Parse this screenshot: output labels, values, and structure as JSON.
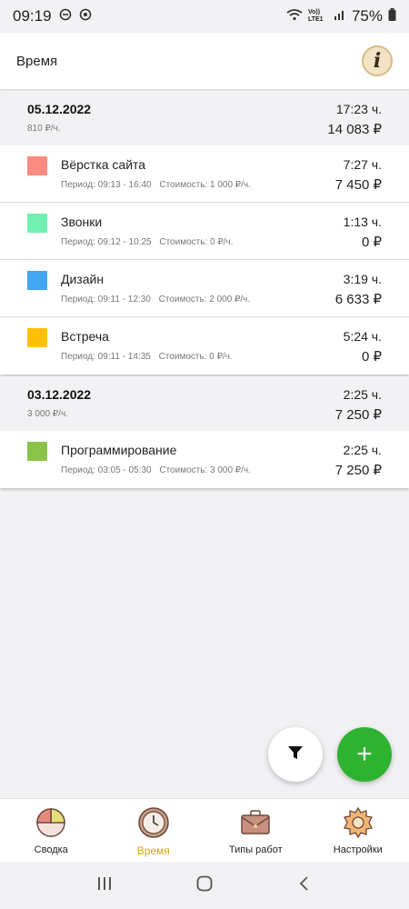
{
  "status": {
    "time": "09:19",
    "battery": "75%",
    "network_label": "Vo)) LTE1"
  },
  "app_bar": {
    "title": "Время",
    "info_glyph": "i"
  },
  "days": [
    {
      "date": "05.12.2022",
      "rate": "810 ₽/ч.",
      "hours": "17:23 ч.",
      "sum": "14 083 ₽",
      "tasks": [
        {
          "name": "Вёрстка сайта",
          "color": "#ff8a80",
          "period": "Период: 09:13 - 16:40",
          "cost": "Стоимость: 1 000 ₽/ч.",
          "hours": "7:27 ч.",
          "sum": "7 450 ₽"
        },
        {
          "name": "Звонки",
          "color": "#6ff0b0",
          "period": "Период: 09:12 - 10:25",
          "cost": "Стоимость: 0 ₽/ч.",
          "hours": "1:13 ч.",
          "sum": "0 ₽"
        },
        {
          "name": "Дизайн",
          "color": "#42a5f5",
          "period": "Период: 09:11 - 12:30",
          "cost": "Стоимость: 2 000 ₽/ч.",
          "hours": "3:19 ч.",
          "sum": "6 633 ₽"
        },
        {
          "name": "Встреча",
          "color": "#ffc107",
          "period": "Период: 09:11 - 14:35",
          "cost": "Стоимость: 0 ₽/ч.",
          "hours": "5:24 ч.",
          "sum": "0 ₽"
        }
      ]
    },
    {
      "date": "03.12.2022",
      "rate": "3 000 ₽/ч.",
      "hours": "2:25 ч.",
      "sum": "7 250 ₽",
      "tasks": [
        {
          "name": "Программирование",
          "color": "#8bc34a",
          "period": "Период: 03:05 - 05:30",
          "cost": "Стоимость: 3 000 ₽/ч.",
          "hours": "2:25 ч.",
          "sum": "7 250 ₽"
        }
      ]
    }
  ],
  "fab": {
    "add_glyph": "+",
    "filter_icon": "filter-icon"
  },
  "bottom_nav": [
    {
      "label": "Сводка",
      "icon": "pie-chart-icon",
      "active": false
    },
    {
      "label": "Время",
      "icon": "clock-icon",
      "active": true
    },
    {
      "label": "Типы работ",
      "icon": "briefcase-icon",
      "active": false
    },
    {
      "label": "Настройки",
      "icon": "gear-icon",
      "active": false
    }
  ],
  "colors": {
    "accent_active": "#d9a11f",
    "fab_add": "#2eb331"
  }
}
